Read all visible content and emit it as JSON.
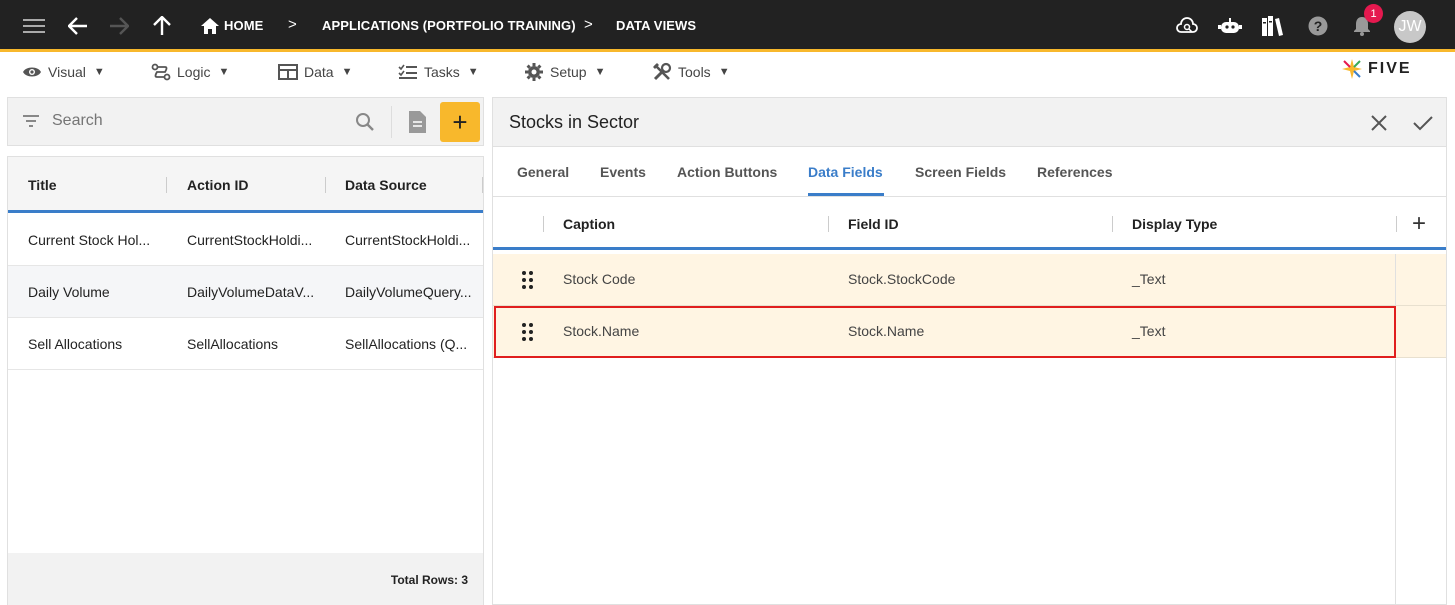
{
  "topbar": {
    "breadcrumbs": [
      "HOME",
      "APPLICATIONS (PORTFOLIO TRAINING)",
      "DATA VIEWS"
    ],
    "notification_count": "1",
    "avatar_initials": "JW"
  },
  "menubar": {
    "items": [
      {
        "label": "Visual",
        "icon": "eye-icon"
      },
      {
        "label": "Logic",
        "icon": "logic-icon"
      },
      {
        "label": "Data",
        "icon": "table-icon"
      },
      {
        "label": "Tasks",
        "icon": "tasks-icon"
      },
      {
        "label": "Setup",
        "icon": "gear-icon"
      },
      {
        "label": "Tools",
        "icon": "tools-icon"
      }
    ],
    "caret": "▼",
    "logo_text": "FIVE"
  },
  "left": {
    "search_placeholder": "Search",
    "add_label": "+",
    "columns": [
      "Title",
      "Action ID",
      "Data Source"
    ],
    "rows": [
      [
        "Current Stock Hol...",
        "CurrentStockHoldi...",
        "CurrentStockHoldi..."
      ],
      [
        "Daily Volume",
        "DailyVolumeDataV...",
        "DailyVolumeQuery..."
      ],
      [
        "Sell Allocations",
        "SellAllocations",
        "SellAllocations (Q..."
      ]
    ],
    "total_rows": "Total Rows: 3"
  },
  "right": {
    "title": "Stocks in Sector",
    "tabs": [
      "General",
      "Events",
      "Action Buttons",
      "Data Fields",
      "Screen Fields",
      "References"
    ],
    "active_tab": "Data Fields",
    "columns": [
      "Caption",
      "Field ID",
      "Display Type"
    ],
    "add_label": "+",
    "rows": [
      [
        "Stock Code",
        "Stock.StockCode",
        "_Text"
      ],
      [
        "Stock.Name",
        "Stock.Name",
        "_Text"
      ]
    ],
    "selected_row": 1
  },
  "colors": {
    "topbar_bg": "#222222",
    "accent": "#f8b82c",
    "active_blue": "#3a7dc9",
    "row_highlight": "#fff5e3",
    "selection_border": "#e01e1e",
    "badge": "#e5194f"
  }
}
